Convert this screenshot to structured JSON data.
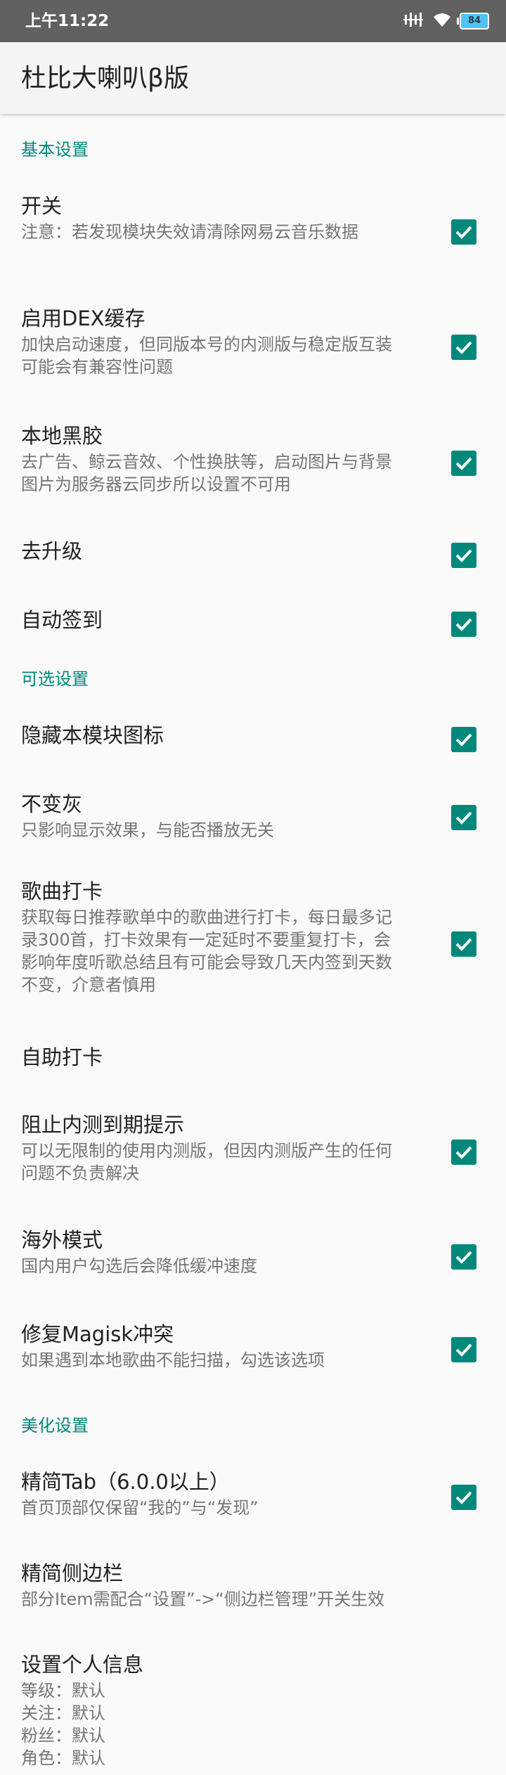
{
  "status_bar": {
    "time": "上午11:22",
    "battery": "84",
    "icons": [
      "vibrate-icon",
      "signal-icon",
      "wifi-icon",
      "battery-icon"
    ]
  },
  "app_bar": {
    "title": "杜比大喇叭β版"
  },
  "colors": {
    "accent": "#00897b",
    "status_bar": "#616161",
    "background": "#fafafa"
  },
  "sections": {
    "basic": {
      "title": "基本设置",
      "switch": {
        "title": "开关",
        "summary": "注意：若发现模块失效请清除网易云音乐数据",
        "checked": true
      },
      "dex_cache": {
        "title": "启用DEX缓存",
        "summary": "加快启动速度，但同版本号的内测版与稳定版互装\n可能会有兼容性问题",
        "checked": true
      },
      "local_vinyl": {
        "title": "本地黑胶",
        "summary": "去广告、鲸云音效、个性换肤等，启动图片与背景\n图片为服务器云同步所以设置不可用",
        "checked": true
      },
      "no_upgrade": {
        "title": "去升级",
        "checked": true
      },
      "auto_sign": {
        "title": "自动签到",
        "checked": true
      }
    },
    "optional": {
      "title": "可选设置",
      "hide_icon": {
        "title": "隐藏本模块图标",
        "checked": true
      },
      "no_gray": {
        "title": "不变灰",
        "summary": "只影响显示效果，与能否播放无关",
        "checked": true
      },
      "song_punch": {
        "title": "歌曲打卡",
        "summary": "获取每日推荐歌单中的歌曲进行打卡，每日最多记\n录300首，打卡效果有一定延时不要重复打卡，会\n影响年度听歌总结且有可能会导致几天内签到天数\n不变，介意者慎用",
        "checked": true
      },
      "self_punch": {
        "title": "自助打卡"
      },
      "block_expire": {
        "title": "阻止内测到期提示",
        "summary": "可以无限制的使用内测版，但因内测版产生的任何\n问题不负责解决",
        "checked": true
      },
      "overseas": {
        "title": "海外模式",
        "summary": "国内用户勾选后会降低缓冲速度",
        "checked": true
      },
      "magisk_fix": {
        "title": "修复Magisk冲突",
        "summary": "如果遇到本地歌曲不能扫描，勾选该选项",
        "checked": true
      }
    },
    "beautify": {
      "title": "美化设置",
      "simple_tab": {
        "title": "精简Tab（6.0.0以上）",
        "summary": "首页顶部仅保留“我的”与“发现”",
        "checked": true
      },
      "simple_sidebar": {
        "title": "精简侧边栏",
        "summary": "部分Item需配合“设置”->“侧边栏管理”开关生效"
      },
      "user_info": {
        "title": "设置个人信息",
        "summary": "等级：默认\n关注：默认\n粉丝：默认\n角色：默认"
      }
    }
  }
}
